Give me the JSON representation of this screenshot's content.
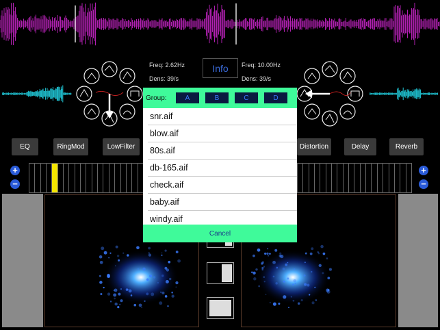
{
  "left_panel": {
    "freq": "Freq: 2.62Hz",
    "dens": "Dens: 39/s"
  },
  "right_panel": {
    "freq": "Freq: 10.00Hz",
    "dens": "Dens: 39/s"
  },
  "info_label": "Info",
  "effects": {
    "eq": "EQ",
    "ringmod": "RingMod",
    "lowfilter": "LowFilter",
    "distortion": "Distortion",
    "delay": "Delay",
    "reverb": "Reverb"
  },
  "controls": {
    "plus": "+",
    "minus": "−"
  },
  "sample_picker": {
    "group_label": "Group:",
    "groups": [
      "A",
      "B",
      "C",
      "D"
    ],
    "files": [
      "snr.aif",
      "blow.aif",
      "80s.aif",
      "db-165.aif",
      "check.aif",
      "baby.aif",
      "windy.aif"
    ],
    "cancel_label": "Cancel"
  },
  "colors": {
    "waveform": "#b020b0",
    "cyan_wave": "#20c8d8",
    "accent": "#3ffa9a",
    "blue_button": "#2a5bd8",
    "slider_active": "#f4e600"
  },
  "step_grid": {
    "left_active_index": 4
  }
}
